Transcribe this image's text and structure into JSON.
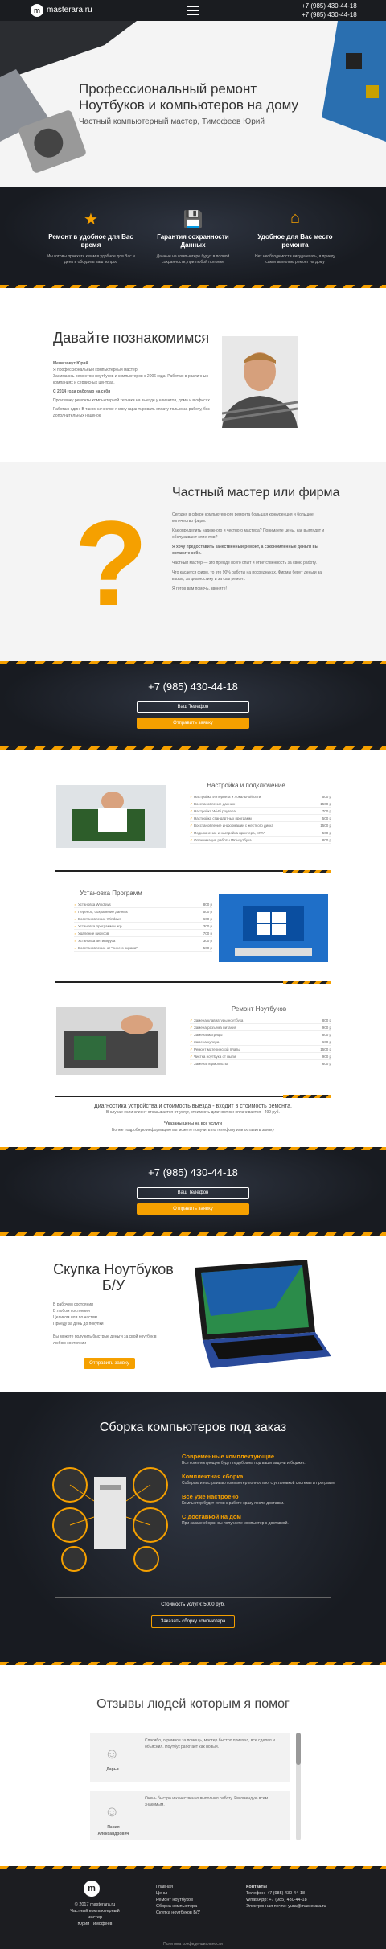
{
  "topbar": {
    "logo_mark": "m",
    "logo_text": "masterara.ru",
    "phone1": "+7 (985) 430-44-18",
    "phone2": "+7 (985) 430-44-18"
  },
  "hero": {
    "title": "Профессиональный ремонт Ноутбуков и компьютеров на дому",
    "subtitle": "Частный компьютерный мастер, Тимофеев Юрий"
  },
  "features": [
    {
      "icon": "star-icon",
      "glyph": "★",
      "title": "Ремонт в удобное для Вас время",
      "text": "Мы готовы приехать к вам в удобное для Вас и день и обсудить ваш вопрос"
    },
    {
      "icon": "floppy-icon",
      "glyph": "💾",
      "title": "Гарантия сохранности Данных",
      "text": "Данные на компьютере будут в полной сохранности, при любой поломке"
    },
    {
      "icon": "home-icon",
      "glyph": "⌂",
      "title": "Удобное для Вас место ремонта",
      "text": "Нет необходимости никуда ехать, я приеду сам и выполню ремонт на дому"
    }
  ],
  "intro": {
    "title": "Давайте познакомимся",
    "p1": "Меня зовут Юрий",
    "p2": "Я профессиональный компьютерный мастер",
    "p3": "Занимаюсь ремонтом ноутбуков и компьютеров с 2006 года. Работаю в различных компаниях и сервисных центрах.",
    "p4": "С 2014 года работаю на себя",
    "p5": "Произвожу ремонты компьютерной техники на выезде у клиентов, дома и в офисах.",
    "p6": "Работаю один. В таком качестве я могу гарантировать оплату только за работу, без дополнительных наценок."
  },
  "about": {
    "title": "Частный мастер или фирма",
    "p1": "Сегодня в сфере компьютерного ремонта большая конкуренция и большое количество фирм.",
    "p2": "Как определить надежного и честного мастера? Понимаете цены, как выглядят и обслуживают клиентов?",
    "p3": "Я хочу предоставить качественный ремонт, а сэкономленные деньги вы оставите себе.",
    "p4": "Частный мастер — это прежде всего опыт и ответственность за свою работу.",
    "p5": "Что касается фирм, то это 90% работы на посредниках. Фирмы берут деньги за вызов, за диагностику и за сам ремонт.",
    "p6": "Я готов вам помочь, звоните!"
  },
  "call1": {
    "phone": "+7 (985) 430-44-18",
    "btn1": "Ваш Телефон",
    "btn2": "Отправить заявку"
  },
  "services": {
    "setup_title": "Настройка и подключение",
    "setup": [
      [
        "Настройка Интернета и локальной сети",
        "500 р"
      ],
      [
        "Восстановление данных",
        "1500 р"
      ],
      [
        "Настройка Wi-Fi роутера",
        "700 р"
      ],
      [
        "Настройка стандартных программ",
        "500 р"
      ],
      [
        "Восстановление информации с жесткого диска",
        "1500 р"
      ],
      [
        "Подключение и настройка принтера, МФУ",
        "500 р"
      ],
      [
        "Оптимизация работы ПК/ноутбука",
        "800 р"
      ]
    ],
    "install_title": "Установка Программ",
    "install": [
      [
        "Установка Windows",
        "800 р"
      ],
      [
        "Перенос, сохранение данных",
        "500 р"
      ],
      [
        "Восстановление Windows",
        "600 р"
      ],
      [
        "Установка программ и игр",
        "300 р"
      ],
      [
        "Удаление вирусов",
        "700 р"
      ],
      [
        "Установка антивируса",
        "300 р"
      ],
      [
        "Восстановление от \"синего экрана\"",
        "500 р"
      ]
    ],
    "repair_title": "Ремонт Ноутбуков",
    "repair": [
      [
        "Замена клавиатуры ноутбука",
        "800 р"
      ],
      [
        "Замена разъема питания",
        "900 р"
      ],
      [
        "Замена матрицы",
        "800 р"
      ],
      [
        "Замена кулера",
        "600 р"
      ],
      [
        "Ремонт материнской платы",
        "1500 р"
      ],
      [
        "Чистка ноутбука от пыли",
        "900 р"
      ],
      [
        "Замена термопасты",
        "600 р"
      ]
    ],
    "note1": "Диагностика устройства и стоимость выезда - входит в стоимость ремонта.",
    "note2": "В случае если клиент отказывается от услуг, стоимость диагностики оплачивается - 499 руб.",
    "note3": "*Указаны цены на все услуги",
    "note4": "Более подробную информацию вы можете получить по телефону или оставить заявку"
  },
  "call2": {
    "phone": "+7 (985) 430-44-18",
    "btn1": "Ваш Телефон",
    "btn2": "Отправить заявку"
  },
  "buyup": {
    "title": "Скупка Ноутбуков Б/У",
    "items": [
      "В рабочем состоянии",
      "В любом состоянии",
      "Целиком или по частям",
      "Приеду за день до покупки"
    ],
    "text": "Вы можете получить быстрые деньги за свой ноутбук в любом состоянии",
    "btn": "Отправить заявку"
  },
  "build": {
    "title": "Сборка компьютеров под заказ",
    "h1": "Современные комплектующие",
    "t1": "Все комплектующие будут подобраны под ваши задачи и бюджет.",
    "h2": "Комплектная сборка",
    "t2": "Собираю и настраиваю компьютер полностью, с установкой системы и программ.",
    "h3": "Все уже настроено",
    "t3": "Компьютер будет готов к работе сразу после доставки.",
    "h4": "С доставкой на дом",
    "t4": "При заказе сборки вы получаете компьютер с доставкой.",
    "price": "Стоимость услуги: 5000 руб.",
    "btn": "Заказать сборку компьютера"
  },
  "reviews": {
    "title": "Отзывы людей которым я помог",
    "r1_name": "Дарья",
    "r1_text": "Спасибо, огромное за помощь, мастер быстро приехал, все сделал и объяснил. Ноутбук работает как новый.",
    "r2_name": "Павел Александрович",
    "r2_text": "Очень быстро и качественно выполнил работу. Рекомендую всем знакомым."
  },
  "footer": {
    "copy": "© 2017 masterara.ru",
    "name1": "Частный компьютерный мастер",
    "name2": "Юрий Тимофеев",
    "nav": [
      "Главная",
      "Цены",
      "Ремонт ноутбуков",
      "Сборка компьютера",
      "Скупка ноутбуков Б/У"
    ],
    "contacts_title": "Контакты",
    "c1": "Телефон: +7 (985) 430-44-18",
    "c2": "WhatsApp: +7 (985) 430-44-18",
    "c3": "Электронная почта: yura@masterara.ru",
    "bottom": "Политика конфиденциальности"
  }
}
